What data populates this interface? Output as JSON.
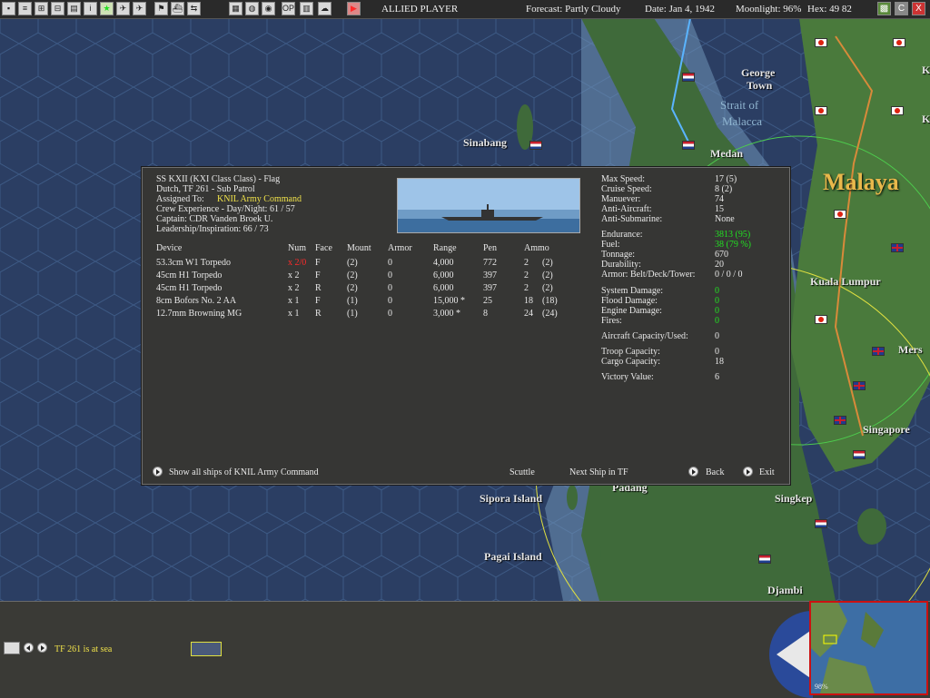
{
  "topbar": {
    "player": "ALLIED PLAYER",
    "forecast": "Forecast: Partly Cloudy",
    "date": "Date: Jan 4, 1942",
    "moonlight": "Moonlight: 96%",
    "hex": "Hex: 49 82",
    "buttons": [
      "",
      "",
      "",
      "",
      "i",
      "",
      "",
      "",
      "",
      "",
      "",
      "",
      "",
      "",
      "OP",
      "",
      ""
    ],
    "right_buttons": [
      "",
      "C",
      "X"
    ]
  },
  "map_labels": {
    "george_town": "George\nTown",
    "george": "George",
    "town": "Town",
    "strait1": "Strait of",
    "strait2": "Malacca",
    "malaya": "Malaya",
    "sinabang": "Sinabang",
    "medan": "Medan",
    "kuala_lumpur": "Kuala Lumpur",
    "singapore": "Singapore",
    "mers": "Mers",
    "padang": "Padang",
    "sipora": "Sipora Island",
    "singkep": "Singkep",
    "pagai": "Pagai Island",
    "djambi": "Djambi",
    "k1": "K",
    "k2": "K"
  },
  "ship": {
    "name_line": "SS KXII (KXI Class Class) - Flag",
    "tf_line": "Dutch, TF 261 - Sub Patrol",
    "assigned_label": "Assigned To:",
    "assigned_value": "KNIL Army Command",
    "crew_exp": "Crew Experience - Day/Night: 61 / 57",
    "captain": "Captain: CDR Vanden Broek U.",
    "leadership": "Leadership/Inspiration: 66 / 73"
  },
  "devices": {
    "headers": [
      "Device",
      "Num",
      "Face",
      "Mount",
      "Armor",
      "Range",
      "Pen",
      "Ammo"
    ],
    "rows": [
      {
        "device": "53.3cm W1 Torpedo",
        "num": "x 2/0",
        "face": "F",
        "mount": "(2)",
        "armor": "0",
        "range": "4,000",
        "pen": "772",
        "ammo": "2",
        "ammo2": "(2)"
      },
      {
        "device": "45cm H1 Torpedo",
        "num": "x 2",
        "face": "F",
        "mount": "(2)",
        "armor": "0",
        "range": "6,000",
        "pen": "397",
        "ammo": "2",
        "ammo2": "(2)"
      },
      {
        "device": "45cm H1 Torpedo",
        "num": "x 2",
        "face": "R",
        "mount": "(2)",
        "armor": "0",
        "range": "6,000",
        "pen": "397",
        "ammo": "2",
        "ammo2": "(2)"
      },
      {
        "device": "8cm Bofors No. 2 AA",
        "num": "x 1",
        "face": "F",
        "mount": "(1)",
        "armor": "0",
        "range": "15,000 *",
        "pen": "25",
        "ammo": "18",
        "ammo2": "(18)"
      },
      {
        "device": "12.7mm Browning MG",
        "num": "x 1",
        "face": "R",
        "mount": "(1)",
        "armor": "0",
        "range": "3,000 *",
        "pen": "8",
        "ammo": "24",
        "ammo2": "(24)"
      }
    ]
  },
  "stats": {
    "max_speed_label": "Max Speed:",
    "max_speed": "17 (5)",
    "cruise_label": "Cruise Speed:",
    "cruise": "8 (2)",
    "manuever_label": "Manuever:",
    "manuever": "74",
    "aa_label": "Anti-Aircraft:",
    "aa": "15",
    "asw_label": "Anti-Submarine:",
    "asw": "None",
    "endurance_label": "Endurance:",
    "endurance": "3813 (95)",
    "fuel_label": "Fuel:",
    "fuel": "38 (79 %)",
    "tonnage_label": "Tonnage:",
    "tonnage": "670",
    "durability_label": "Durability:",
    "durability": "20",
    "armor_label": "Armor: Belt/Deck/Tower:",
    "armor": "0 / 0 / 0",
    "sys_dmg_label": "System Damage:",
    "sys_dmg": "0",
    "flood_label": "Flood Damage:",
    "flood": "0",
    "engine_label": "Engine Damage:",
    "engine": "0",
    "fires_label": "Fires:",
    "fires": "0",
    "aircraft_label": "Aircraft Capacity/Used:",
    "aircraft": "0",
    "troop_label": "Troop Capacity:",
    "troop": "0",
    "cargo_label": "Cargo Capacity:",
    "cargo": "18",
    "victory_label": "Victory Value:",
    "victory": "6"
  },
  "footer": {
    "show_all": "Show all ships of KNIL Army Command",
    "scuttle": "Scuttle",
    "next_ship": "Next Ship in TF",
    "back": "Back",
    "exit": "Exit"
  },
  "bottom": {
    "status": "TF 261 is at sea",
    "minimap_label": "98%"
  },
  "colors": {
    "sea": "#2b3e63",
    "land": "#3f6a3a",
    "dialog_bg": "#363634",
    "highlight_yellow": "#f0e24a",
    "ok_green": "#22e022",
    "warn_red": "#ff2a2a"
  }
}
